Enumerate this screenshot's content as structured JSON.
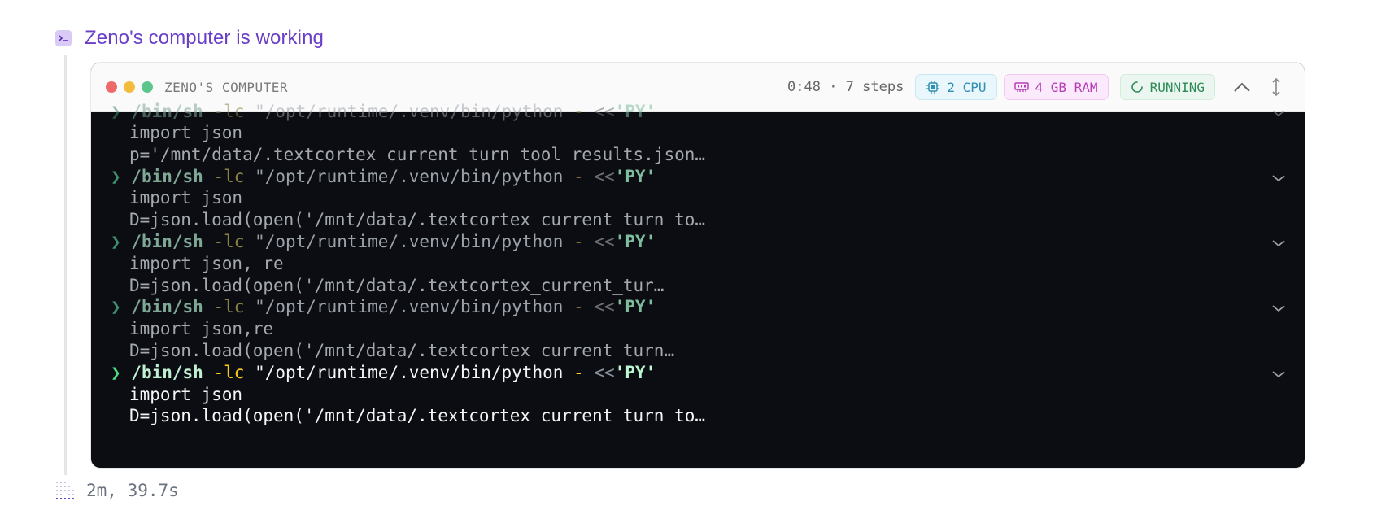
{
  "header": {
    "title": "Zeno's computer is working"
  },
  "card": {
    "name": "ZENO'S COMPUTER",
    "elapsed": "0:48 · 7 steps",
    "cpu": "2 CPU",
    "ram": "4 GB RAM",
    "status": "RUNNING"
  },
  "commands": [
    {
      "prompt": "❯",
      "path": "/bin/sh",
      "flag": "-lc",
      "arg": "\"/opt/runtime/.venv/bin/python",
      "op": "-",
      "heredoc": "<<",
      "py": "'PY'",
      "line1": "import json",
      "line2": "p='/mnt/data/.textcortex_current_turn_tool_results.json…"
    },
    {
      "prompt": "❯",
      "path": "/bin/sh",
      "flag": "-lc",
      "arg": "\"/opt/runtime/.venv/bin/python",
      "op": "-",
      "heredoc": "<<",
      "py": "'PY'",
      "line1": "import json",
      "line2": "D=json.load(open('/mnt/data/.textcortex_current_turn_to…"
    },
    {
      "prompt": "❯",
      "path": "/bin/sh",
      "flag": "-lc",
      "arg": "\"/opt/runtime/.venv/bin/python",
      "op": "-",
      "heredoc": "<<",
      "py": "'PY'",
      "line1": "import json, re",
      "line2": "D=json.load(open('/mnt/data/.textcortex_current_tur…"
    },
    {
      "prompt": "❯",
      "path": "/bin/sh",
      "flag": "-lc",
      "arg": "\"/opt/runtime/.venv/bin/python",
      "op": "-",
      "heredoc": "<<",
      "py": "'PY'",
      "line1": "import json,re",
      "line2": "D=json.load(open('/mnt/data/.textcortex_current_turn…"
    },
    {
      "prompt": "❯",
      "path": "/bin/sh",
      "flag": "-lc",
      "arg": "\"/opt/runtime/.venv/bin/python",
      "op": "-",
      "heredoc": "<<",
      "py": "'PY'",
      "line1": "import json",
      "line2": "D=json.load(open('/mnt/data/.textcortex_current_turn_to…"
    }
  ],
  "footer": {
    "duration": "2m, 39.7s"
  },
  "colors": {
    "accent": "#6a3fc8",
    "terminal_bg": "#0b0d12",
    "dot_red": "#ee6a6a",
    "dot_yellow": "#f2bd3c",
    "dot_green": "#5cc58a"
  },
  "icons": [
    "terminal-icon",
    "cpu-icon",
    "ram-icon",
    "spinner-icon",
    "chevron-up-icon",
    "expand-icon",
    "chevron-down-icon",
    "grid-dots-icon"
  ]
}
